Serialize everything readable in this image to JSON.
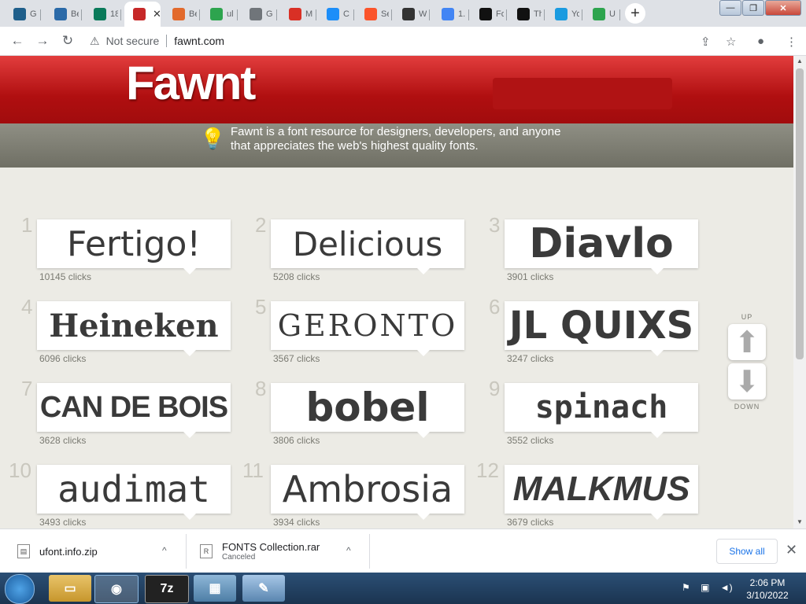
{
  "tabs": [
    {
      "icon": "gamepad-icon",
      "title": "G",
      "color": "#1f5f8b"
    },
    {
      "icon": "tr-icon",
      "title": "Be",
      "color": "#2b6aa8"
    },
    {
      "icon": "m-icon",
      "title": "18",
      "color": "#0a7a5a"
    },
    {
      "icon": "f-icon",
      "title": "",
      "color": "#c62828",
      "active": true,
      "close": "✕"
    },
    {
      "icon": "fire-icon",
      "title": "Be",
      "color": "#e26a2c"
    },
    {
      "icon": "drive-icon",
      "title": "ul",
      "color": "#2da44e"
    },
    {
      "icon": "globe-icon",
      "title": "G",
      "color": "#70757a"
    },
    {
      "icon": "mail-icon",
      "title": "M",
      "color": "#d93025"
    },
    {
      "icon": "appstore-icon",
      "title": "C",
      "color": "#1c8ef9"
    },
    {
      "icon": "brave-icon",
      "title": "Se",
      "color": "#fb542b"
    },
    {
      "icon": "museum-icon",
      "title": "W",
      "color": "#333333"
    },
    {
      "icon": "google-icon",
      "title": "1.",
      "color": "#4285f4"
    },
    {
      "icon": "pp-icon",
      "title": "Fo",
      "color": "#111111"
    },
    {
      "icon": "pp-icon",
      "title": "Th",
      "color": "#111111"
    },
    {
      "icon": "lb-icon",
      "title": "Yo",
      "color": "#1a9be0"
    },
    {
      "icon": "drive-icon",
      "title": "U",
      "color": "#2da44e"
    }
  ],
  "newtab_label": "+",
  "window_buttons": {
    "min": "—",
    "max": "❐",
    "close": "✕"
  },
  "toolbar": {
    "back": "←",
    "forward": "→",
    "reload": "↻",
    "warning": "⚠",
    "not_secure": "Not secure",
    "url": "fawnt.com",
    "share": "⇪",
    "star": "☆",
    "profile": "●",
    "menu": "⋮"
  },
  "site": {
    "logo": "Fawnt",
    "tagline": "Fawnt is a font resource for designers, developers, and anyone that appreciates the web's highest quality fonts.",
    "bulb": "💡",
    "updown": {
      "up_label": "UP",
      "down_label": "DOWN",
      "up_arrow": "⬆",
      "down_arrow": "⬇"
    }
  },
  "fonts": [
    {
      "num": "1",
      "name": "Fertigo!",
      "clicks": "10145 clicks"
    },
    {
      "num": "2",
      "name": "Delicious",
      "clicks": "5208 clicks"
    },
    {
      "num": "3",
      "name": "Diavlo",
      "clicks": "3901 clicks"
    },
    {
      "num": "4",
      "name": "Heineken",
      "clicks": "6096 clicks"
    },
    {
      "num": "5",
      "name": "GERONTO",
      "clicks": "3567 clicks"
    },
    {
      "num": "6",
      "name": "JL QUIXS",
      "clicks": "3247 clicks"
    },
    {
      "num": "7",
      "name": "CAN DE BOIS",
      "clicks": "3628 clicks"
    },
    {
      "num": "8",
      "name": "bobel",
      "clicks": "3806 clicks"
    },
    {
      "num": "9",
      "name": "spinach",
      "clicks": "3552 clicks"
    },
    {
      "num": "10",
      "name": "audimat",
      "clicks": "3493 clicks"
    },
    {
      "num": "11",
      "name": "Ambrosia",
      "clicks": "3934 clicks"
    },
    {
      "num": "12",
      "name": "MALKMUS",
      "clicks": "3679 clicks"
    }
  ],
  "downloads": [
    {
      "name": "ufont.info.zip",
      "status": ""
    },
    {
      "name": "FONTS Collection.rar",
      "status": "Canceled"
    }
  ],
  "download_bar": {
    "show_all": "Show all",
    "close": "✕",
    "chevron": "^"
  },
  "taskbar": {
    "apps": [
      "folder-icon",
      "chrome-icon",
      "7z-icon",
      "control-panel-icon",
      "paint-icon"
    ],
    "app_7z": "7z",
    "time": "2:06 PM",
    "date": "3/10/2022"
  }
}
